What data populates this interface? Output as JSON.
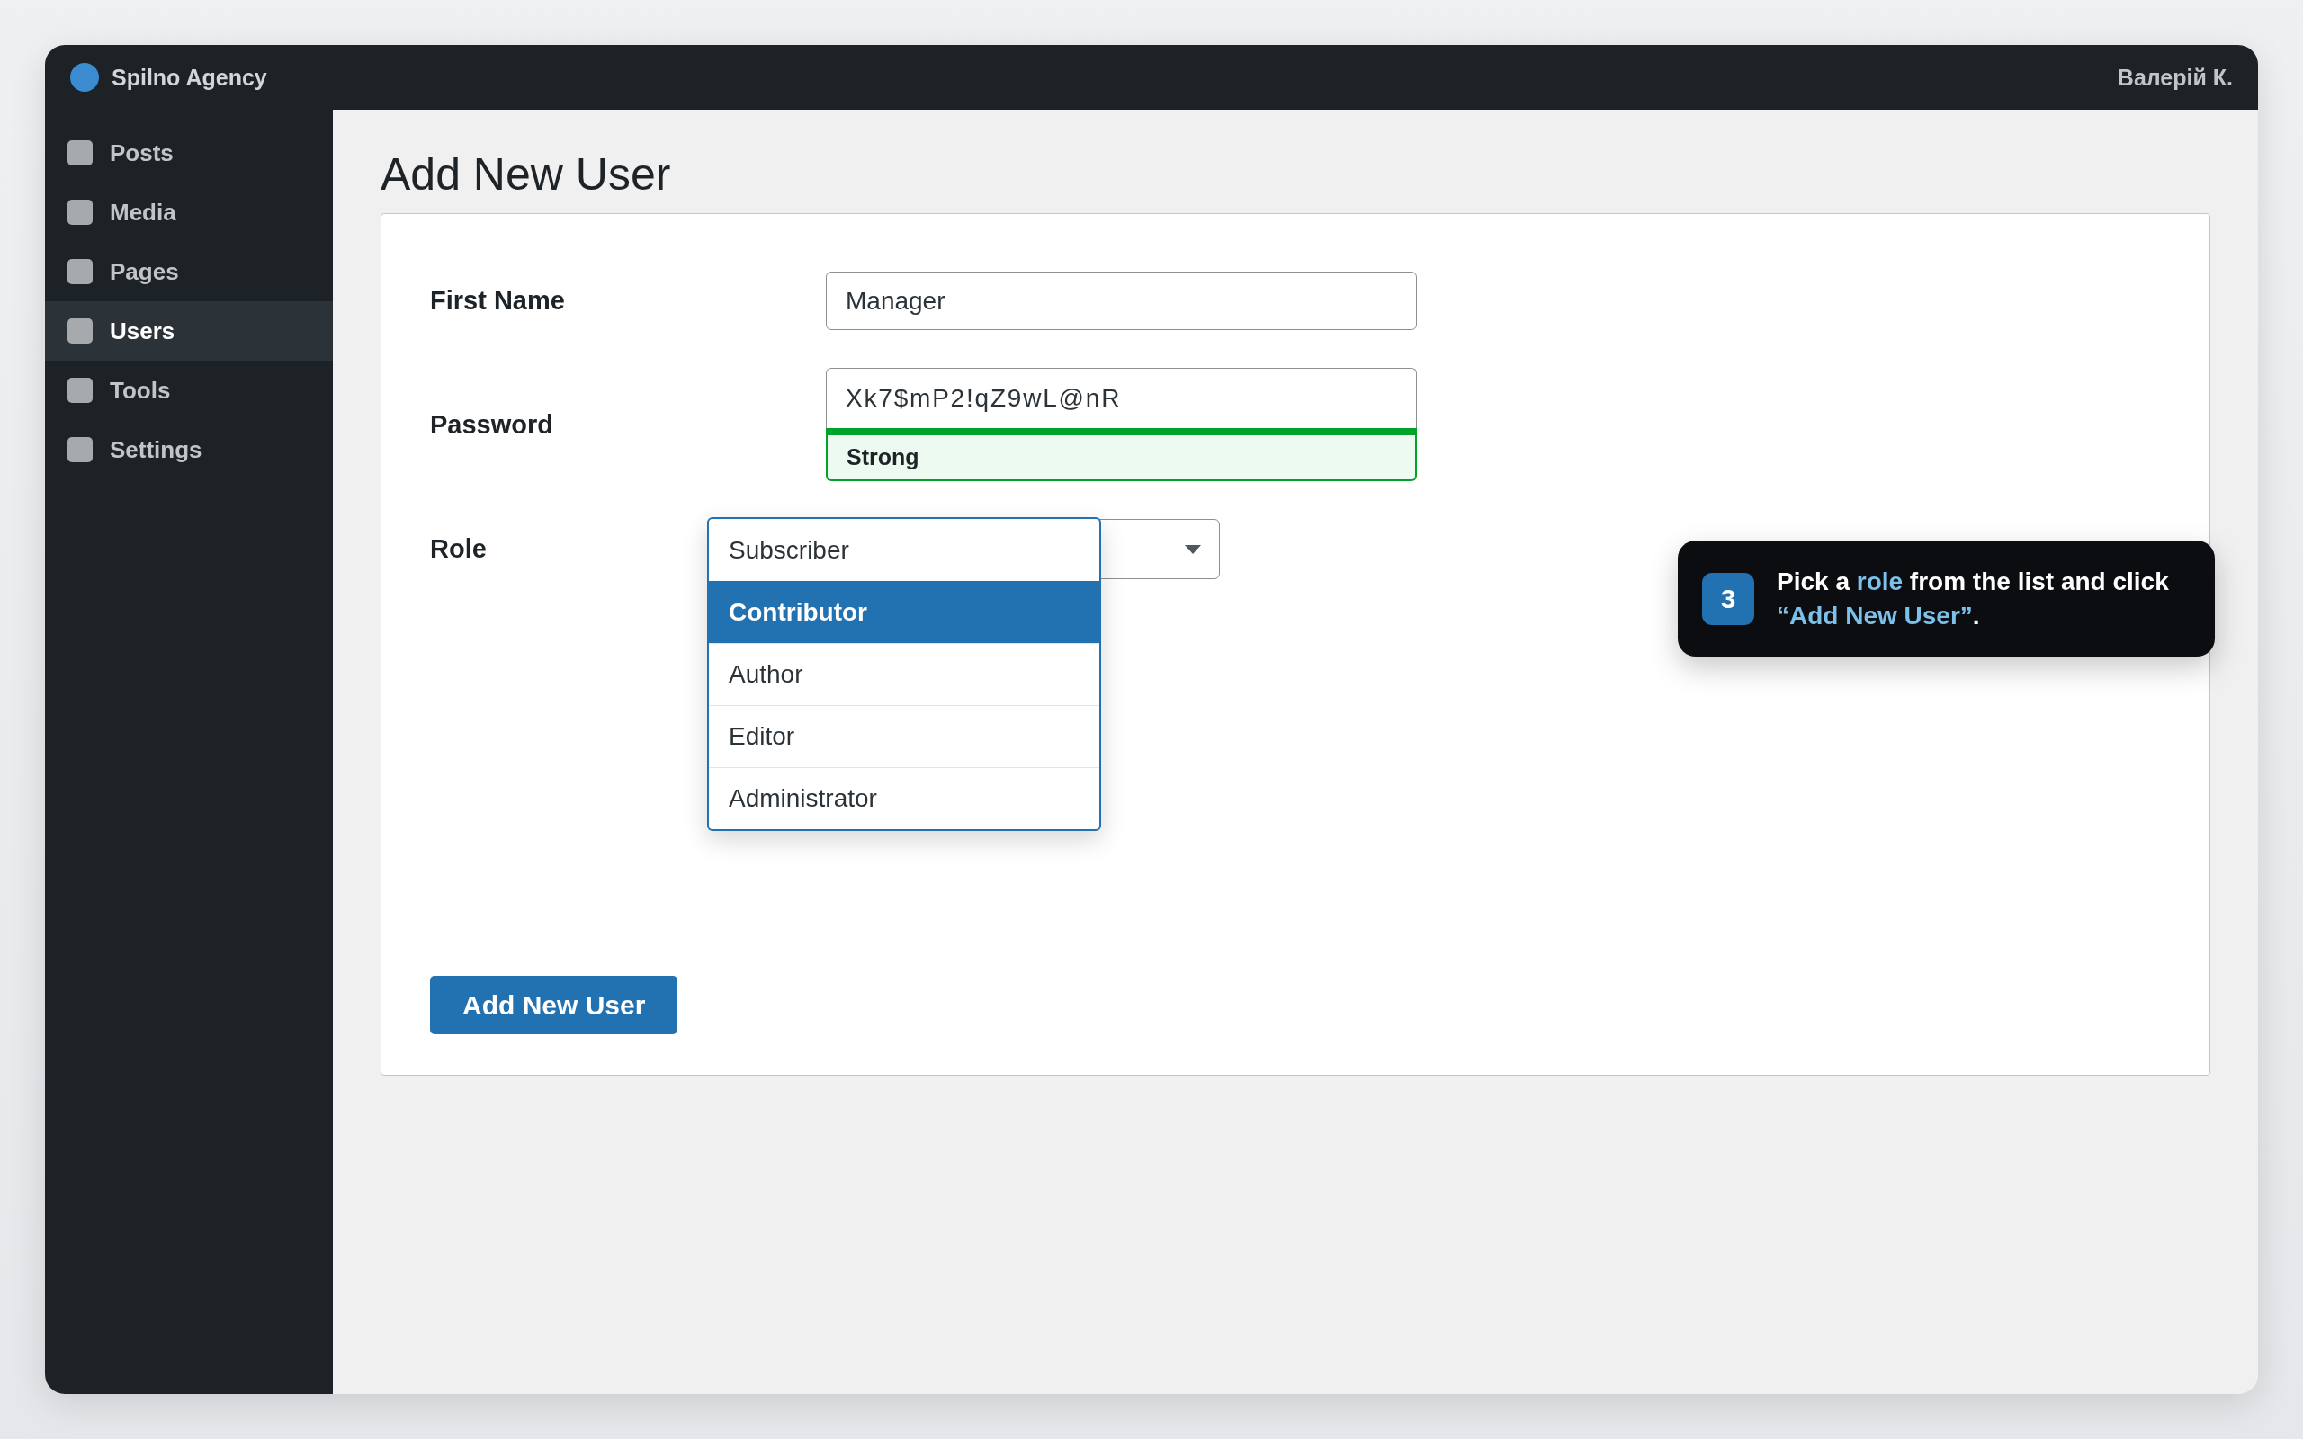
{
  "top_bar": {
    "site_name": "Spilno Agency",
    "user_name": "Валерій К."
  },
  "sidebar": {
    "items": [
      {
        "label": "Posts",
        "selected": false
      },
      {
        "label": "Media",
        "selected": false
      },
      {
        "label": "Pages",
        "selected": false
      },
      {
        "label": "Users",
        "selected": true
      },
      {
        "label": "Tools",
        "selected": false
      },
      {
        "label": "Settings",
        "selected": false
      }
    ]
  },
  "page_title": "Add New User",
  "form": {
    "fields": [
      {
        "kind": "text",
        "label": "First Name",
        "value": "Manager"
      },
      {
        "kind": "password",
        "label": "Password",
        "value": "Xk7$mP2!qZ9wL@nR",
        "strength": {
          "label": "Strong",
          "level": 1
        }
      },
      {
        "kind": "select",
        "label": "Role",
        "expanded": true,
        "options": [
          {
            "label": "Subscriber",
            "selected": false
          },
          {
            "label": "Contributor",
            "selected": true
          },
          {
            "label": "Author",
            "selected": false
          },
          {
            "label": "Editor",
            "selected": false
          },
          {
            "label": "Administrator",
            "selected": false
          }
        ]
      }
    ],
    "submit_button": "Add New User"
  },
  "tooltip": {
    "step": "3",
    "text": "Pick a **role** from the list and click **“Add New User”**."
  }
}
